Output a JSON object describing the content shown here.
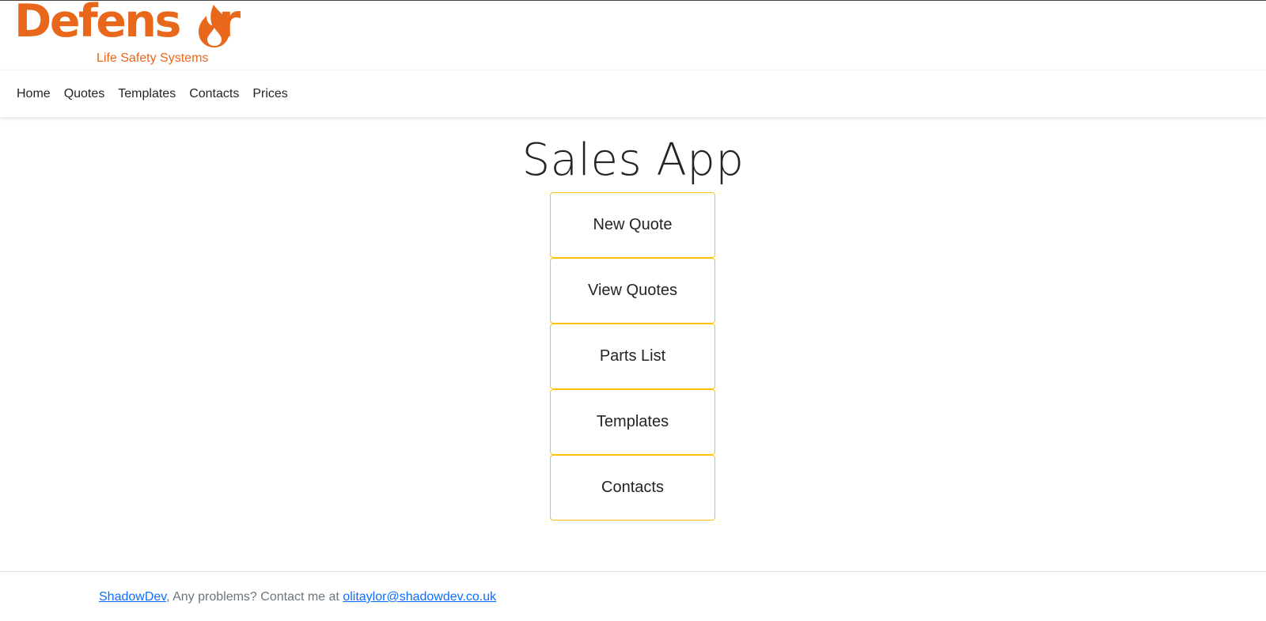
{
  "brand": {
    "logo_word": "Defensor",
    "logo_tagline": "Life Safety Systems",
    "logo_color": "#e8671b",
    "flame_icon": "flame-icon"
  },
  "nav": {
    "items": [
      {
        "label": "Home"
      },
      {
        "label": "Quotes"
      },
      {
        "label": "Templates"
      },
      {
        "label": "Contacts"
      },
      {
        "label": "Prices"
      }
    ]
  },
  "main": {
    "title": "Sales App",
    "buttons": [
      {
        "label": "New Quote"
      },
      {
        "label": "View Quotes"
      },
      {
        "label": "Parts List"
      },
      {
        "label": "Templates"
      },
      {
        "label": "Contacts"
      }
    ],
    "button_border_color": "#ffc107"
  },
  "footer": {
    "link_label": "ShadowDev",
    "text": ", Any problems? Contact me at ",
    "email": "olitaylor@shadowdev.co.uk",
    "link_color": "#0d6efd"
  }
}
